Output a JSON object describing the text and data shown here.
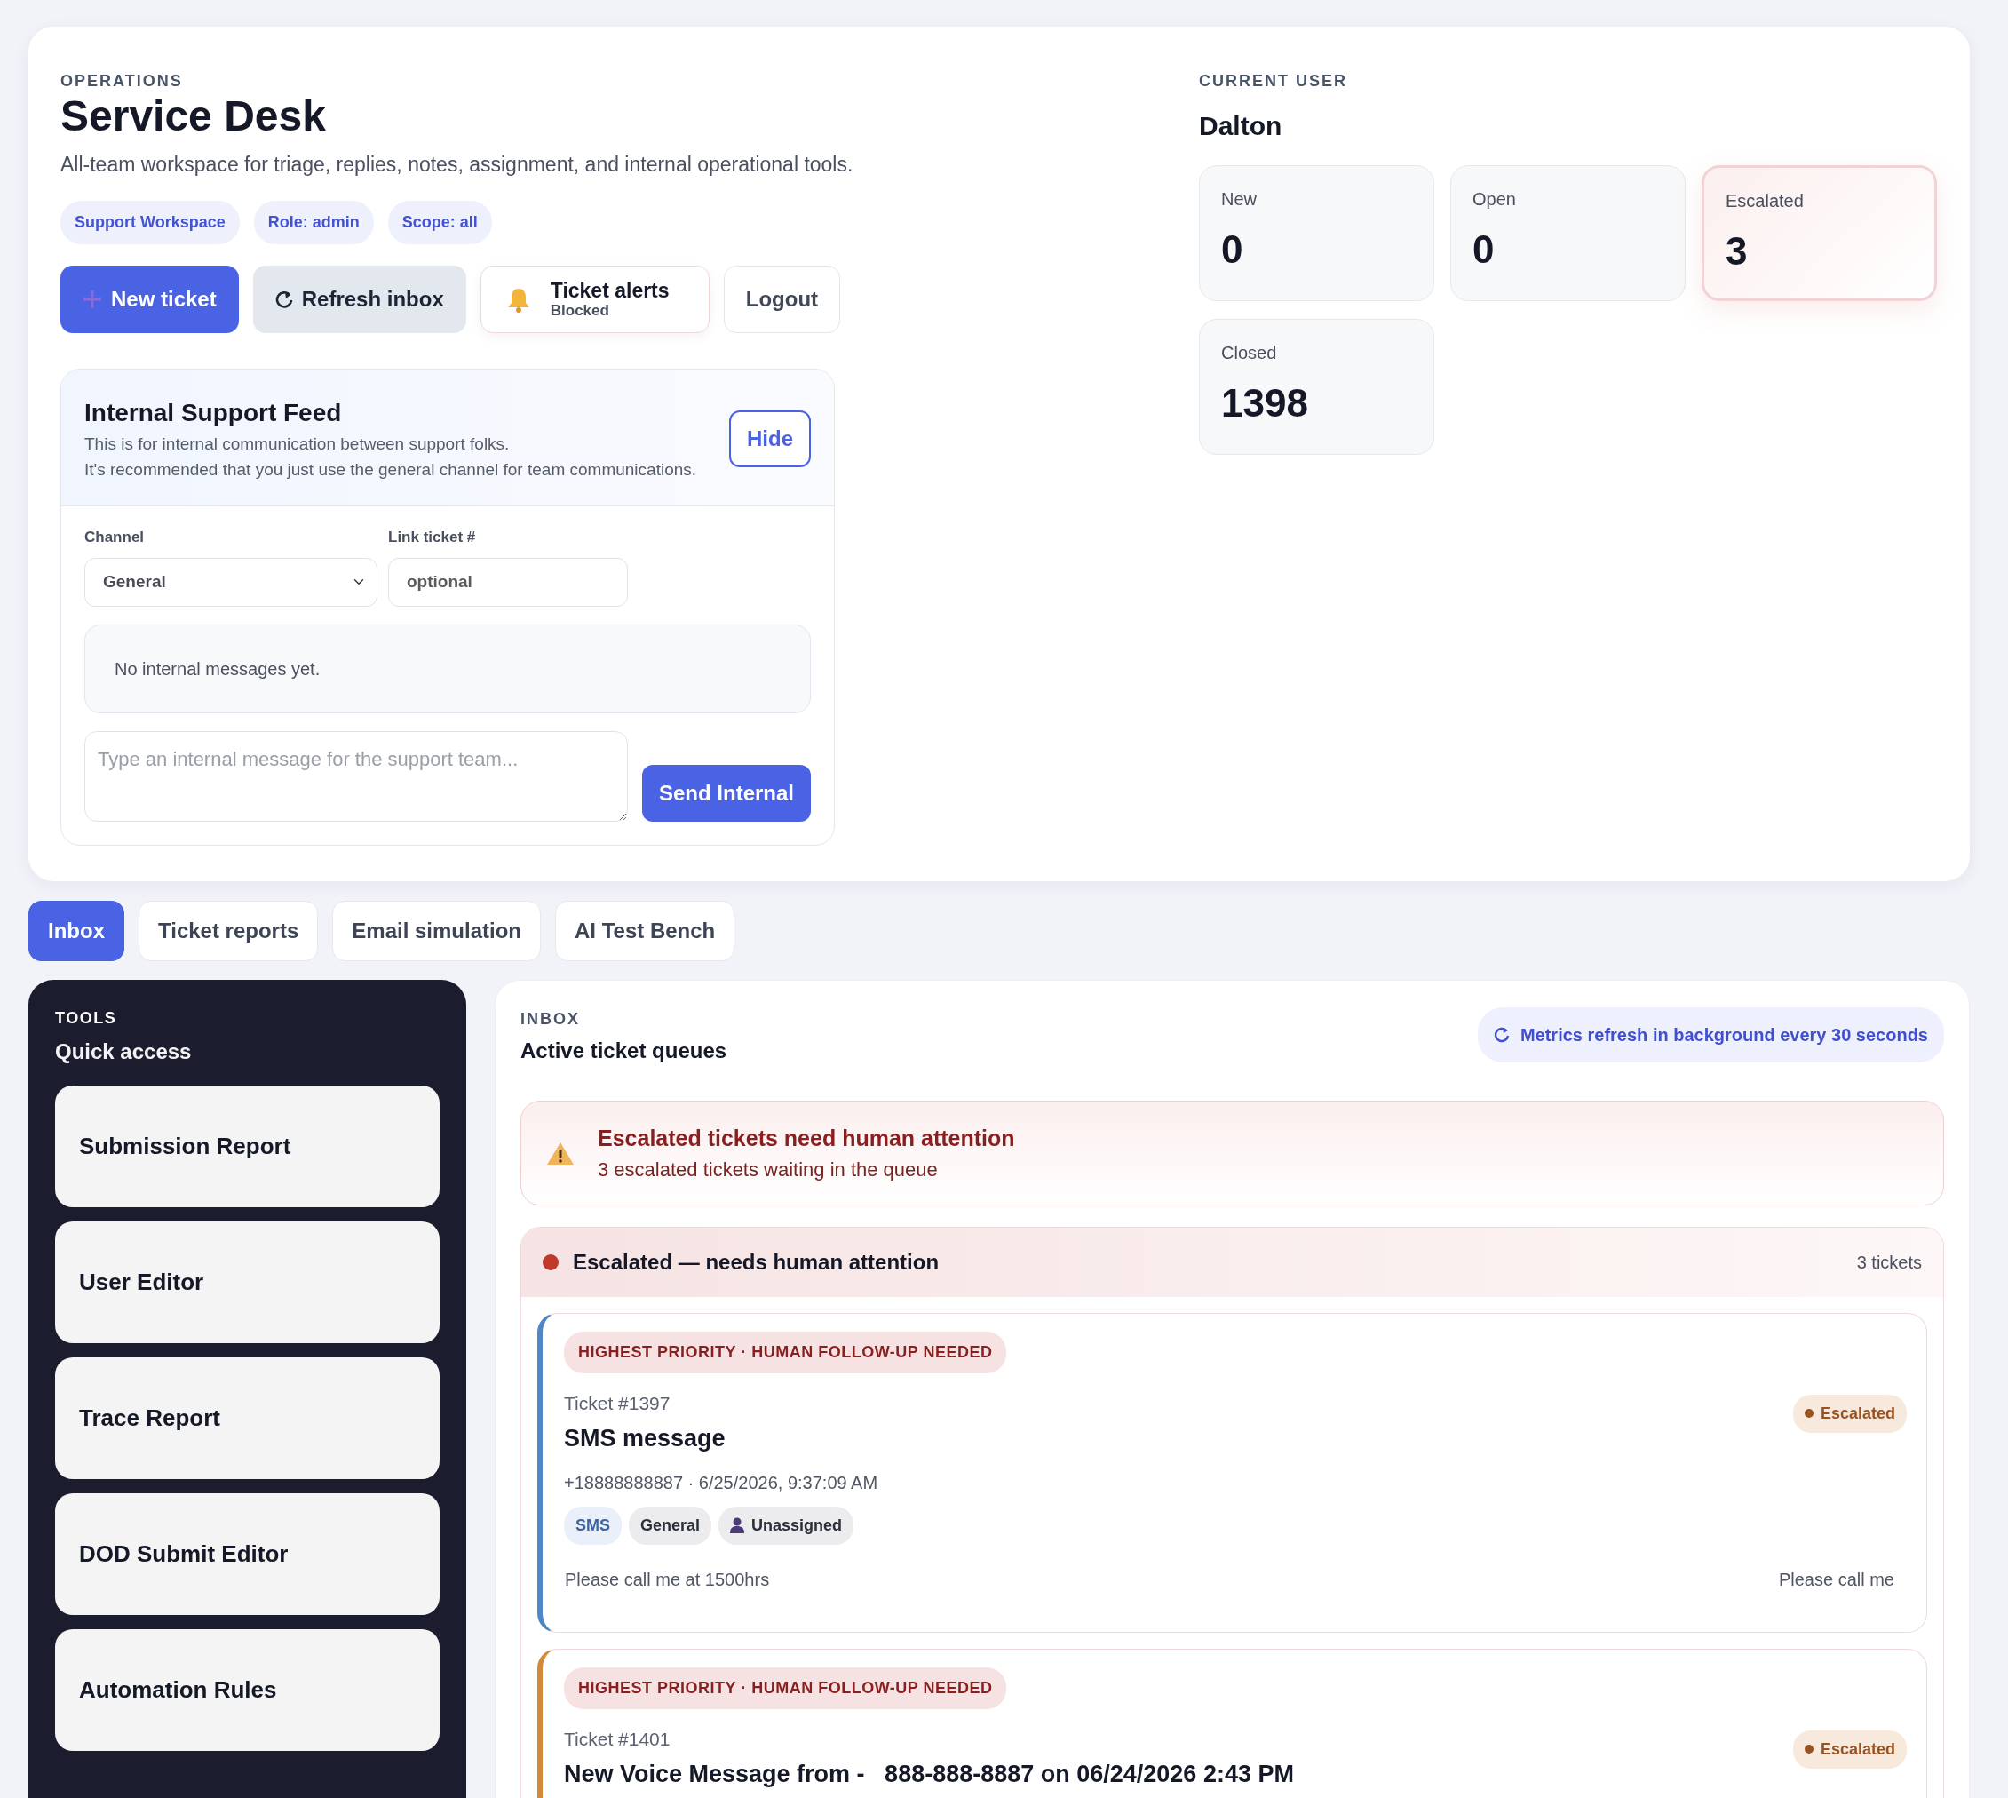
{
  "header": {
    "eyebrow": "OPERATIONS",
    "title": "Service Desk",
    "description": "All-team workspace for triage, replies, notes, assignment, and internal operational tools.",
    "badges": [
      "Support Workspace",
      "Role: admin",
      "Scope: all"
    ],
    "new_ticket": "New ticket",
    "refresh": "Refresh inbox",
    "alerts": {
      "title": "Ticket alerts",
      "status": "Blocked"
    },
    "logout": "Logout"
  },
  "feed": {
    "title": "Internal Support Feed",
    "lines": [
      "This is for internal communication between support folks.",
      "It's recommended that you just use the general channel for team communications."
    ],
    "hide": "Hide",
    "channel": {
      "label": "Channel",
      "value": "General"
    },
    "link": {
      "label": "Link ticket #",
      "placeholder": "optional"
    },
    "empty": "No internal messages yet.",
    "message_placeholder": "Type an internal message for the support team...",
    "send": "Send Internal"
  },
  "current_user": {
    "eyebrow": "CURRENT USER",
    "name": "Dalton",
    "stats": [
      {
        "label": "New",
        "value": "0",
        "highlighted": false
      },
      {
        "label": "Open",
        "value": "0",
        "highlighted": false
      },
      {
        "label": "Escalated",
        "value": "3",
        "highlighted": true
      },
      {
        "label": "Closed",
        "value": "1398",
        "highlighted": false
      }
    ]
  },
  "tabs": [
    {
      "label": "Inbox",
      "selected": true
    },
    {
      "label": "Ticket reports",
      "selected": false
    },
    {
      "label": "Email simulation",
      "selected": false
    },
    {
      "label": "AI Test Bench",
      "selected": false
    }
  ],
  "tools": {
    "eyebrow": "TOOLS",
    "title": "Quick access",
    "items": [
      "Submission Report",
      "User Editor",
      "Trace Report",
      "DOD Submit Editor",
      "Automation Rules"
    ]
  },
  "inbox": {
    "eyebrow": "INBOX",
    "title": "Active ticket queues",
    "refresh_note": "Metrics refresh in background every 30 seconds",
    "alert": {
      "title": "Escalated tickets need human attention",
      "text": "3 escalated tickets waiting in the queue"
    },
    "queue": {
      "title": "Escalated — needs human attention",
      "count": "3 tickets",
      "tickets": [
        {
          "priority": "HIGHEST PRIORITY · HUMAN FOLLOW-UP NEEDED",
          "number": "Ticket #1397",
          "title": "SMS message",
          "status": "Escalated",
          "color": "#4f86c6",
          "meta": "+18888888887 · 6/25/2026, 9:37:09 AM",
          "tags": [
            {
              "kind": "channel",
              "label": "SMS"
            },
            {
              "kind": "category",
              "label": "General"
            },
            {
              "kind": "assignee",
              "label": "Unassigned"
            }
          ],
          "preview": "Please call me at 1500hrs",
          "snippet": "Please call me"
        },
        {
          "priority": "HIGHEST PRIORITY · HUMAN FOLLOW-UP NEEDED",
          "number": "Ticket #1401",
          "title": "New Voice Message from -   888-888-8887 on 06/24/2026 2:43 PM",
          "status": "Escalated",
          "color": "#d08a3a"
        }
      ]
    }
  }
}
